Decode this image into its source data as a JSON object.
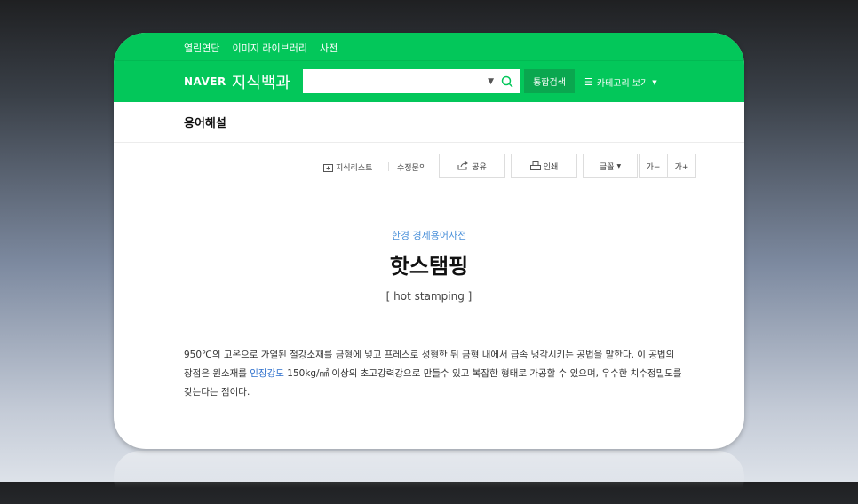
{
  "topnav": [
    "열린연단",
    "이미지 라이브러리",
    "사전"
  ],
  "logo": {
    "brand": "NAVER",
    "service": "지식백과"
  },
  "search": {
    "value": "",
    "placeholder": "",
    "button": "통합검색"
  },
  "category": {
    "label": "카테고리 보기"
  },
  "section_title": "용어해설",
  "toolbar": {
    "knowledge_list": "지식리스트",
    "edit_request": "수정문의",
    "share": "공유",
    "print": "인쇄",
    "font": "글꼴",
    "font_smaller": "가−",
    "font_larger": "가+"
  },
  "article": {
    "dictionary": "한경 경제용어사전",
    "title": "핫스탬핑",
    "english": "[ hot stamping ]",
    "body_pre": "950℃의 고온으로 가열된 철강소재를 금형에 넣고 프레스로 성형한 뒤 금형 내에서 급속 냉각시키는 공법을 말한다. 이 공법의 장점은 원소재를 ",
    "body_link": "인장강도",
    "body_post": " 150kg/㎟ 이상의 초고강력강으로 만들수 있고 복잡한 형태로 가공할 수 있으며, 우수한 치수정밀도를 갖는다는 점이다."
  },
  "colors": {
    "brand_green": "#03c75a",
    "button_green": "#0aa74f",
    "link_blue": "#4a90d9"
  }
}
